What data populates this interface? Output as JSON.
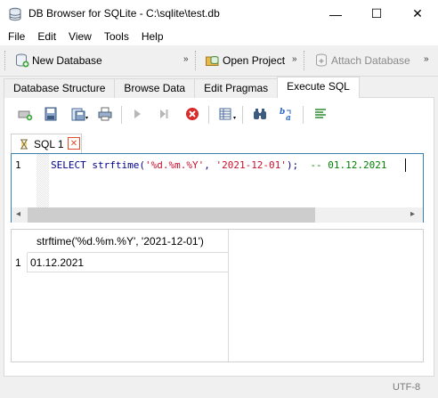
{
  "window": {
    "title": "DB Browser for SQLite - C:\\sqlite\\test.db",
    "minimize": "—",
    "maximize": "☐",
    "close": "✕"
  },
  "menu": {
    "items": [
      "File",
      "Edit",
      "View",
      "Tools",
      "Help"
    ]
  },
  "toolbar": {
    "new_database": "New Database",
    "open_project": "Open Project",
    "attach_database": "Attach Database",
    "chevron": "»"
  },
  "tabs": [
    {
      "label": "Database Structure",
      "active": false
    },
    {
      "label": "Browse Data",
      "active": false
    },
    {
      "label": "Edit Pragmas",
      "active": false
    },
    {
      "label": "Execute SQL",
      "active": true
    }
  ],
  "editor_tab": {
    "label": "SQL 1",
    "close": "✕"
  },
  "editor": {
    "line_number": "1",
    "tokens": {
      "keyword": "SELECT strftime(",
      "arg1": "'%d.%m.%Y'",
      "sep": ", ",
      "arg2": "'2021-12-01'",
      "end": ");  ",
      "comment": "-- 01.12.2021"
    },
    "scroll_left": "◂",
    "scroll_right": "▸"
  },
  "results": {
    "column_header": "strftime('%d.%m.%Y', '2021-12-01')",
    "row_number": "1",
    "cell_value": "01.12.2021"
  },
  "status": {
    "encoding": "UTF-8"
  }
}
